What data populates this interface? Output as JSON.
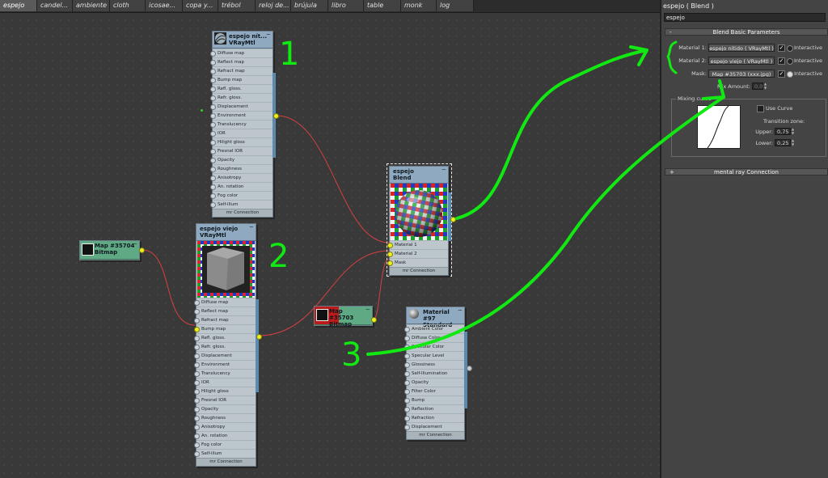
{
  "tabs": [
    "espejo",
    "candel...",
    "ambiente",
    "cloth",
    "icosae...",
    "copa y...",
    "trébol",
    "reloj de...",
    "brújula",
    "libro",
    "table",
    "monk",
    "log"
  ],
  "active_tab": 0,
  "vray_slots": [
    "Diffuse map",
    "Reflect map",
    "Refract map",
    "Bump map",
    "Refl. gloss.",
    "Refr. gloss.",
    "Displacement",
    "Environment",
    "Translucency",
    "IOR",
    "Hilight gloss",
    "Fresnel IOR",
    "Opacity",
    "Roughness",
    "Anisotropy",
    "An. rotation",
    "Fog color",
    "Self-illum"
  ],
  "standard_slots": [
    "Ambient Color",
    "Diffuse Color",
    "Specular Color",
    "Specular Level",
    "Glossiness",
    "Self-Illumination",
    "Opacity",
    "Filter Color",
    "Bump",
    "Reflection",
    "Refraction",
    "Displacement"
  ],
  "blend_slots": [
    "Material 1",
    "Material 2",
    "Mask"
  ],
  "connection_label": "mr Connection",
  "nodes": {
    "vray1": {
      "name": "espejo nít...",
      "type": "VRayMtl"
    },
    "vray2": {
      "name": "espejo viejo",
      "type": "VRayMtl"
    },
    "blend": {
      "name": "espejo",
      "type": "Blend"
    },
    "bitmap1": {
      "name": "Map #35704",
      "type": "Bitmap"
    },
    "bitmap2": {
      "name": "Map #35703",
      "type": "Bitmap"
    },
    "standard": {
      "name": "Material #97",
      "type": "Standard"
    }
  },
  "annotations": [
    "1",
    "2",
    "3"
  ],
  "annotation_color": "#12e812",
  "wire_color": "#d84040",
  "panel": {
    "title": "espejo  ( Blend )",
    "name_value": "espejo",
    "rollout_basic": "Blend Basic Parameters",
    "material1_label": "Material 1:",
    "material1_value": "espejo nítido  ( VRayMtl )",
    "material2_label": "Material 2:",
    "material2_value": "espejo viejo  ( VRayMtl )",
    "mask_label": "Mask:",
    "mask_value": "Map #35703 (xxx.jpg)",
    "interactive_label": "Interactive",
    "mix_amount_label": "Mix Amount:",
    "mix_amount_value": "0,0",
    "mixing_curve_label": "Mixing curve",
    "use_curve_label": "Use Curve",
    "transition_zone_label": "Transition zone:",
    "upper_label": "Upper:",
    "upper_value": "0,75",
    "lower_label": "Lower:",
    "lower_value": "0,25",
    "rollout_mr": "mental ray Connection",
    "rollout_basic_sign": "-",
    "rollout_mr_sign": "+"
  }
}
